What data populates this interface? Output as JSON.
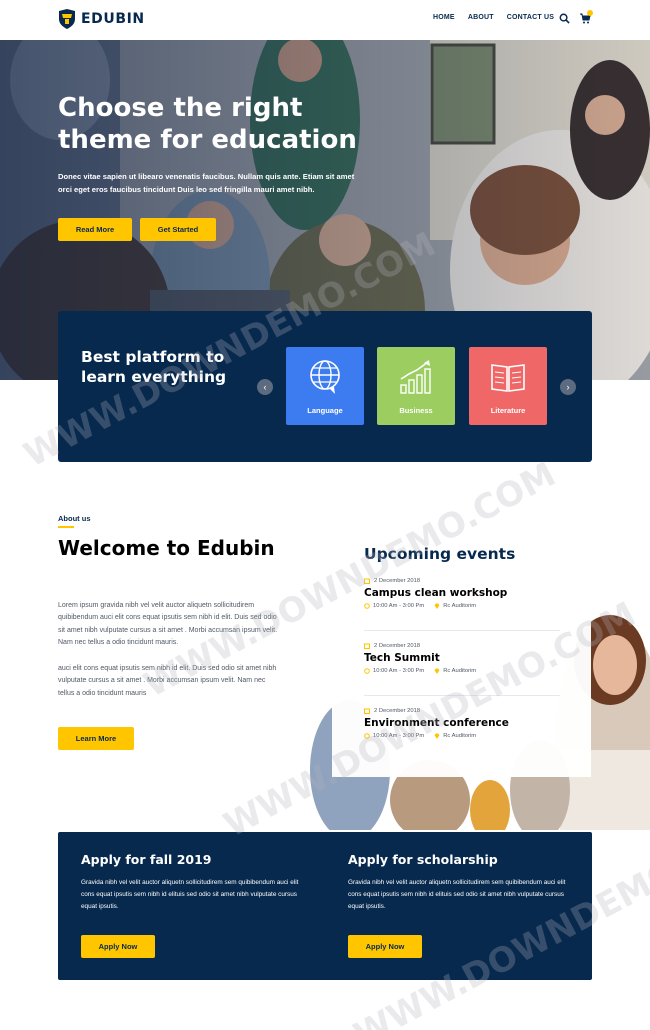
{
  "header": {
    "brand": "EDUBIN",
    "nav": [
      "HOME",
      "ABOUT",
      "CONTACT US"
    ]
  },
  "hero": {
    "title": "Choose the right theme for education",
    "subtitle": "Donec vitae sapien ut libearo venenatis faucibus. Nullam quis ante. Etiam sit amet orci eget eros faucibus tincidunt Duis leo sed fringilla mauri amet nibh.",
    "btn_read_more": "Read More",
    "btn_get_started": "Get Started"
  },
  "categories": {
    "title": "Best platform to learn everything",
    "items": [
      {
        "label": "Language",
        "icon": "globe-chat-icon",
        "color": "#3d7cf0"
      },
      {
        "label": "Business",
        "icon": "growth-chart-icon",
        "color": "#9ccd60"
      },
      {
        "label": "Literature",
        "icon": "open-book-icon",
        "color": "#f06768"
      }
    ]
  },
  "about": {
    "kicker": "About us",
    "title": "Welcome to Edubin",
    "p1": "Lorem ipsum gravida nibh vel velit auctor aliquetn sollicitudirem quibibendum auci elit cons equat ipsutis sem nibh id elit. Duis sed odio sit amet nibh vulputate cursus a sit amet . Morbi accumsan ipsum velit. Nam nec tellus a odio tincidunt mauris.",
    "p2": "auci elit cons equat ipsutis sem nibh id elit. Duis sed odio sit amet nibh vulputate cursus a sit amet . Morbi accumsan ipsum velit. Nam nec tellus a odio tincidunt mauris",
    "button": "Learn More"
  },
  "events": {
    "title": "Upcoming events",
    "items": [
      {
        "date": "2 December 2018",
        "name": "Campus clean workshop",
        "time": "10:00 Am - 3:00 Pm",
        "place": "Rc Auditorim"
      },
      {
        "date": "2 December 2018",
        "name": "Tech Summit",
        "time": "10:00 Am - 3:00 Pm",
        "place": "Rc Auditorim"
      },
      {
        "date": "2 December 2018",
        "name": "Environment conference",
        "time": "10:00 Am - 3:00 Pm",
        "place": "Rc Auditorim"
      }
    ]
  },
  "apply": [
    {
      "title": "Apply for fall 2019",
      "text": "Gravida nibh vel velit auctor aliquetn sollicitudirem sem quibibendum auci elit cons equat ipsutis sem nibh id elituis sed odio sit amet nibh vulputate cursus equat ipsutis.",
      "button": "Apply Now"
    },
    {
      "title": "Apply for scholarship",
      "text": "Gravida nibh vel velit auctor aliquetn sollicitudirem sem quibibendum auci elit cons equat ipsutis sem nibh id elituis sed odio sit amet nibh vulputate cursus equat ipsutis.",
      "button": "Apply Now"
    }
  ],
  "watermark": "WWW.DOWNDEMO.COM",
  "colors": {
    "navy": "#07294d",
    "accent": "#ffc600"
  }
}
